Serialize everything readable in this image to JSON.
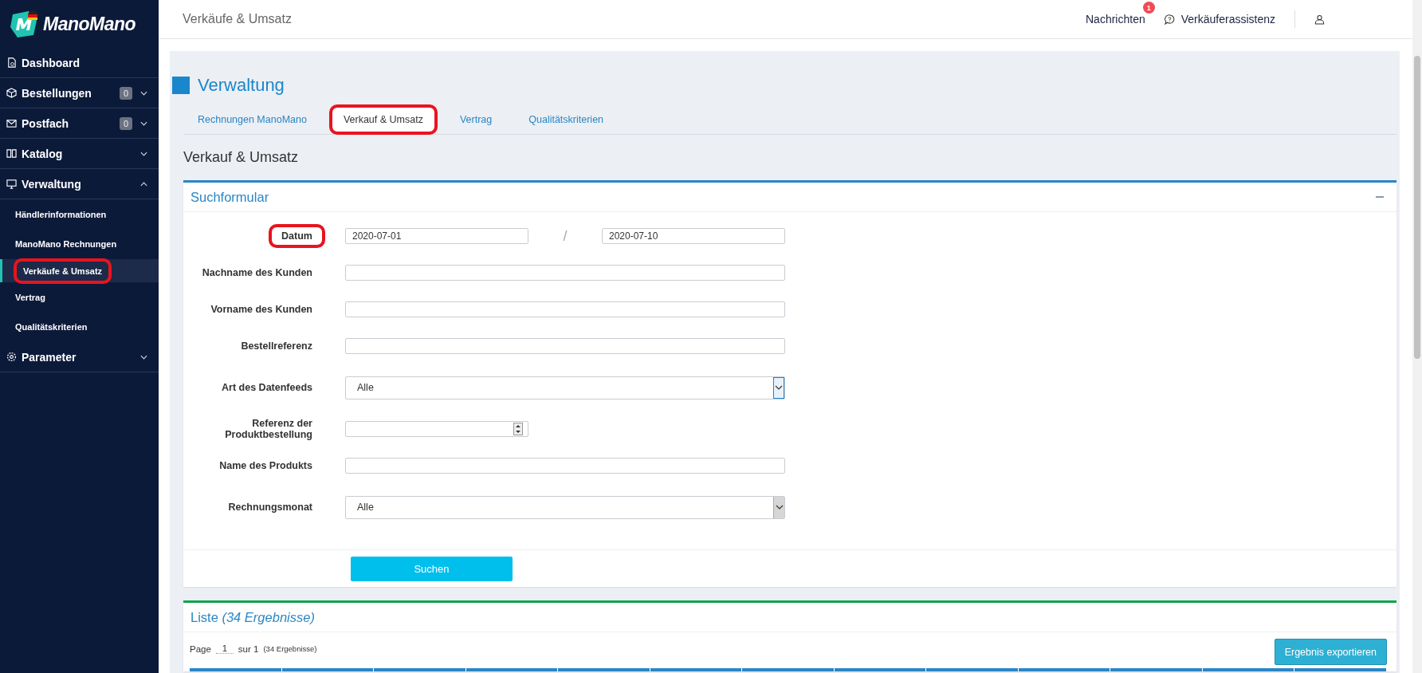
{
  "logo": {
    "text": "ManoMano"
  },
  "sidebar": {
    "items": [
      {
        "label": "Dashboard"
      },
      {
        "label": "Bestellungen",
        "badge": "0",
        "expanded": false
      },
      {
        "label": "Postfach",
        "badge": "0",
        "expanded": false
      },
      {
        "label": "Katalog",
        "expanded": false
      },
      {
        "label": "Verwaltung",
        "expanded": true,
        "children": [
          {
            "label": "Händlerinformationen",
            "selected": false,
            "highlighted": false
          },
          {
            "label": "ManoMano Rechnungen",
            "selected": false,
            "highlighted": false
          },
          {
            "label": "Verkäufe & Umsatz",
            "selected": true,
            "highlighted": true
          },
          {
            "label": "Vertrag",
            "selected": false,
            "highlighted": false
          },
          {
            "label": "Qualitätskriterien",
            "selected": false,
            "highlighted": false
          }
        ]
      },
      {
        "label": "Parameter",
        "expanded": false
      }
    ]
  },
  "header": {
    "title": "Verkäufe & Umsatz",
    "messages": {
      "label": "Nachrichten",
      "badge": "1"
    },
    "assistant": "Verkäuferassistenz"
  },
  "page": {
    "heading": "Verwaltung",
    "tabs": [
      {
        "label": "Rechnungen ManoMano",
        "selected": false,
        "highlighted": false
      },
      {
        "label": "Verkauf & Umsatz",
        "selected": true,
        "highlighted": true
      },
      {
        "label": "Vertrag",
        "selected": false,
        "highlighted": false
      },
      {
        "label": "Qualitätskriterien",
        "selected": false,
        "highlighted": false
      }
    ],
    "subheading": "Verkauf & Umsatz"
  },
  "search_form": {
    "title": "Suchformular",
    "fields": [
      {
        "kind": "daterange",
        "label": "Datum",
        "highlighted": true,
        "from": "2020-07-01",
        "separator": "/",
        "to": "2020-07-10"
      },
      {
        "kind": "text",
        "label": "Nachname des Kunden",
        "highlighted": false
      },
      {
        "kind": "text",
        "label": "Vorname des Kunden",
        "highlighted": false
      },
      {
        "kind": "text",
        "label": "Bestellreferenz",
        "highlighted": false
      },
      {
        "kind": "select",
        "label": "Art des Datenfeeds",
        "value": "Alle",
        "focused": true,
        "highlighted": false
      },
      {
        "kind": "number",
        "label": "Referenz der Produktbestellung",
        "highlighted": false
      },
      {
        "kind": "text",
        "label": "Name des Produkts",
        "highlighted": false
      },
      {
        "kind": "select",
        "label": "Rechnungsmonat",
        "value": "Alle",
        "focused": false,
        "highlighted": false
      }
    ],
    "submit": "Suchen"
  },
  "results": {
    "title": "Liste *(34 Ergebnisse)*",
    "pagination": {
      "page_label": "Page",
      "page": "1",
      "of": "sur 1",
      "count": "(34 Ergebnisse)"
    },
    "export": "Ergebnis exportieren"
  }
}
